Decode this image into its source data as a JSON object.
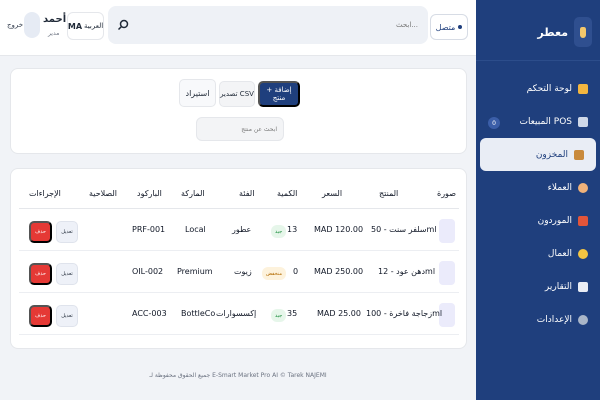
{
  "app": {
    "brand": "معطر"
  },
  "colors": {
    "sidebar": "#1f3f7d",
    "primary": "#1f3f7d",
    "danger": "#e53935"
  },
  "sidebar": {
    "items": [
      {
        "label": "لوحة التحكم",
        "icon": "dashboard-icon"
      },
      {
        "label": "المبيعات POS",
        "icon": "pos-icon",
        "badge": "0"
      },
      {
        "label": "المخزون",
        "icon": "inventory-icon",
        "active": true
      },
      {
        "label": "العملاء",
        "icon": "customers-icon"
      },
      {
        "label": "الموردون",
        "icon": "suppliers-icon"
      },
      {
        "label": "العمال",
        "icon": "workers-icon"
      },
      {
        "label": "التقارير",
        "icon": "reports-icon"
      },
      {
        "label": "الإعدادات",
        "icon": "settings-icon"
      }
    ]
  },
  "topbar": {
    "status": "متصل",
    "search_placeholder": "ابحث...",
    "lang_code": "MA",
    "lang_label": "العربية",
    "user_name": "أحمد",
    "user_role": "مدير",
    "logout": "خروج"
  },
  "actions": {
    "add": "+ إضافة منتج",
    "csv": "تصدير CSV",
    "import": "استيراد",
    "filter_placeholder": "ابحث عن منتج"
  },
  "table": {
    "headers": [
      "صورة",
      "المنتج",
      "السعر",
      "الكمية",
      "الفئة",
      "الماركة",
      "الباركود",
      "الصلاحية",
      "الإجراءات"
    ],
    "rows": [
      {
        "product": "سلفر سنت - 50ml",
        "price": "MAD 120.00",
        "qty": "13",
        "qty_badge": "جيد",
        "qty_status": "ok",
        "category": "عطور",
        "brand": "Local",
        "barcode": "PRF-001",
        "expiry": ""
      },
      {
        "product": "دهن عود - 12ml",
        "price": "MAD 250.00",
        "qty": "0",
        "qty_badge": "منخفض",
        "qty_status": "low",
        "category": "زيوت",
        "brand": "Premium",
        "barcode": "OIL-002",
        "expiry": ""
      },
      {
        "product": "زجاجة فاخرة - 100ml",
        "price": "MAD 25.00",
        "qty": "35",
        "qty_badge": "جيد",
        "qty_status": "ok",
        "category": "إكسسوارات",
        "brand": "BottleCo",
        "barcode": "ACC-003",
        "expiry": ""
      }
    ],
    "edit_label": "تعديل",
    "delete_label": "حذف"
  },
  "footer": {
    "text": "جميع الحقوق محفوظة لـ E-Smart Market Pro AI © Tarek NAJEMI"
  }
}
